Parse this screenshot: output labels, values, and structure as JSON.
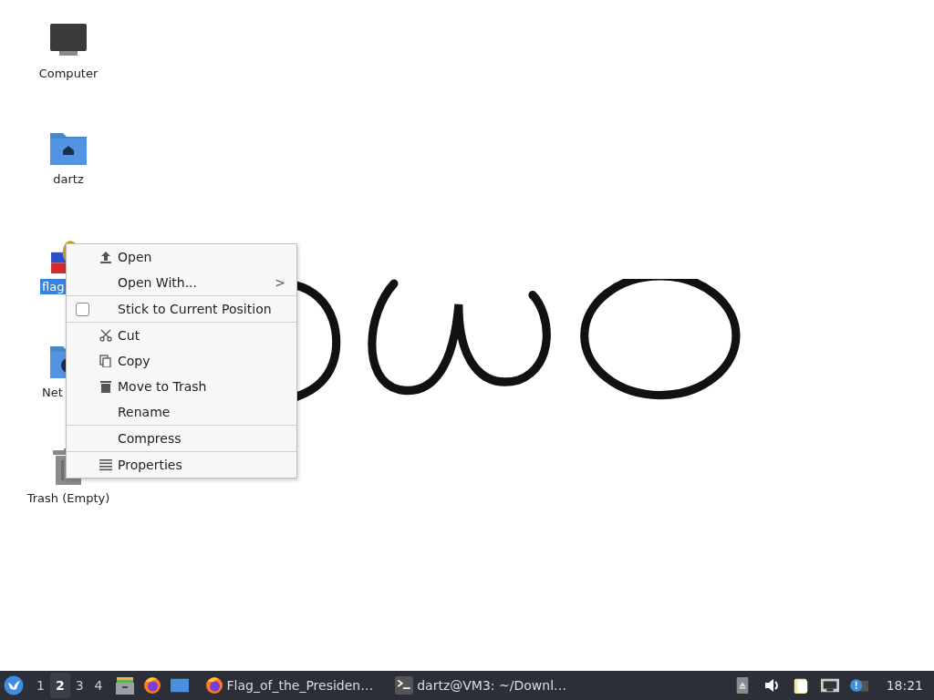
{
  "desktop": {
    "icons": [
      {
        "kind": "computer",
        "label": "Computer",
        "selected": false
      },
      {
        "kind": "home-folder",
        "label": "dartz",
        "selected": false
      },
      {
        "kind": "flag",
        "label": "flag",
        "selected": true
      },
      {
        "kind": "network-folder",
        "label": "Net",
        "selected": false
      },
      {
        "kind": "trash",
        "label": "Trash (Empty)",
        "selected": false
      }
    ]
  },
  "context_menu": {
    "sections": [
      [
        {
          "kind": "open",
          "label": "Open"
        },
        {
          "kind": "submenu",
          "label": "Open With...",
          "arrow": ">"
        }
      ],
      [
        {
          "kind": "checkbox",
          "label": "Stick to Current Position",
          "checked": false
        }
      ],
      [
        {
          "kind": "cut",
          "label": "Cut"
        },
        {
          "kind": "copy",
          "label": "Copy"
        },
        {
          "kind": "trash",
          "label": "Move to Trash"
        },
        {
          "kind": "plain",
          "label": "Rename"
        }
      ],
      [
        {
          "kind": "plain",
          "label": "Compress"
        }
      ],
      [
        {
          "kind": "properties",
          "label": "Properties"
        }
      ]
    ]
  },
  "taskbar": {
    "workspaces": [
      {
        "label": "1",
        "selected": false
      },
      {
        "label": "2",
        "selected": true
      },
      {
        "label": "3",
        "selected": false
      },
      {
        "label": "4",
        "selected": false
      }
    ],
    "launchers": [
      {
        "kind": "files"
      },
      {
        "kind": "browser"
      },
      {
        "kind": "desktop"
      }
    ],
    "tasks": [
      {
        "kind": "browser",
        "label": "Flag_of_the_Presiden…"
      },
      {
        "kind": "terminal",
        "label": "dartz@VM3: ~/Downl…"
      }
    ],
    "tray": [
      {
        "kind": "eject"
      },
      {
        "kind": "volume"
      },
      {
        "kind": "clipboard"
      },
      {
        "kind": "network"
      },
      {
        "kind": "notification"
      }
    ],
    "clock": "18:21"
  }
}
